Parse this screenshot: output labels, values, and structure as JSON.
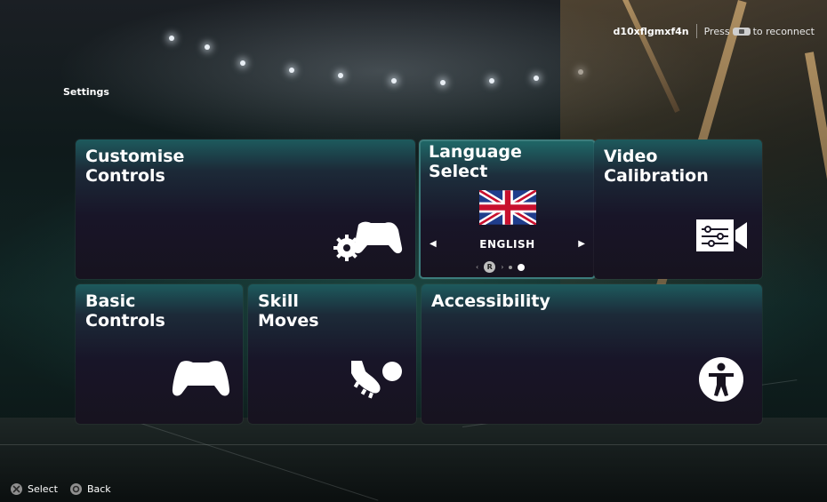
{
  "header": {
    "username": "d10xflgmxf4n",
    "press_text": "Press",
    "reconnect_text": "to reconnect",
    "controller_icon": "controller-pad-icon"
  },
  "page": {
    "title": "Settings"
  },
  "tiles": {
    "customise_controls": {
      "label": "Customise\nControls",
      "icon": "gear-controller-icon"
    },
    "language_select": {
      "label": "Language\nSelect",
      "flag": "uk-flag-icon",
      "current_language": "ENGLISH",
      "pager_button": "R",
      "page": 2,
      "pages": 2
    },
    "video_calibration": {
      "label": "Video\nCalibration",
      "icon": "video-settings-icon"
    },
    "basic_controls": {
      "label": "Basic\nControls",
      "icon": "controller-icon"
    },
    "skill_moves": {
      "label": "Skill\nMoves",
      "icon": "boot-ball-icon"
    },
    "accessibility": {
      "label": "Accessibility",
      "icon": "accessibility-icon"
    }
  },
  "footer": {
    "select_label": "Select",
    "back_label": "Back"
  },
  "colors": {
    "accent_teal": "#1f6767",
    "tile_dark": "#181528"
  }
}
